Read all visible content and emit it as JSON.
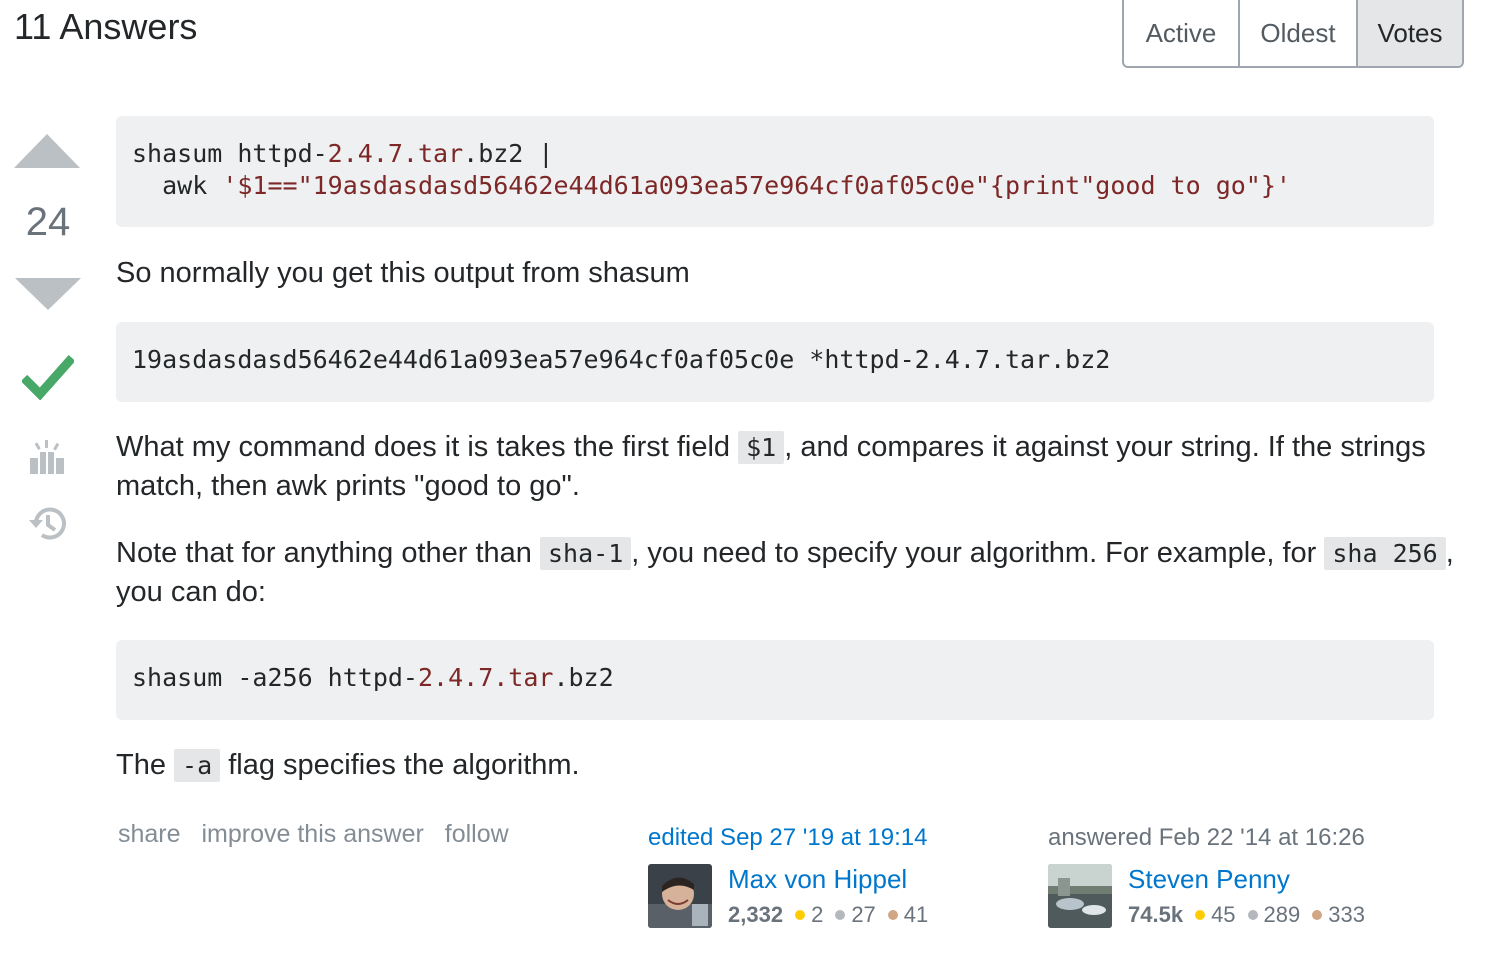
{
  "header": {
    "answers_count": "11 Answers",
    "sort_tabs": [
      {
        "label": "Active",
        "selected": false
      },
      {
        "label": "Oldest",
        "selected": false
      },
      {
        "label": "Votes",
        "selected": true
      }
    ]
  },
  "answer": {
    "score": "24",
    "accepted": true,
    "code_block_1": {
      "line1": [
        "shasum httpd-",
        "2.4.7.tar",
        ".bz2 |"
      ],
      "line2": [
        "  awk ",
        "'$1==\"19asdasdasd56462e44d61a093ea57e964cf0af05c0e\"{print\"good to go\"}'"
      ]
    },
    "paragraph_1": "So normally you get this output from shasum",
    "code_block_2": "19asdasdasd56462e44d61a093ea57e964cf0af05c0e *httpd-2.4.7.tar.bz2",
    "paragraph_2": {
      "text_before": "What my command does it is takes the first field ",
      "code": "$1",
      "text_after": ", and compares it against your string. If the strings match, then awk prints \"good to go\"."
    },
    "paragraph_3": {
      "text_before": "Note that for anything other than ",
      "code_1": "sha-1",
      "text_middle": ", you need to specify your algorithm. For example, for ",
      "code_2": "sha 256",
      "text_after": ", you can do:"
    },
    "code_block_3": [
      "shasum -a256 httpd-",
      "2.4.7.tar",
      ".bz2"
    ],
    "paragraph_4": {
      "text_before": "The ",
      "code": "-a",
      "text_after": " flag specifies the algorithm."
    },
    "post_menu": {
      "share": "share",
      "improve": "improve this answer",
      "follow": "follow"
    },
    "editor": {
      "action": "edited Sep 27 '19 at 19:14",
      "name": "Max von Hippel",
      "reputation": "2,332",
      "gold": "2",
      "silver": "27",
      "bronze": "41"
    },
    "author": {
      "action": "answered Feb 22 '14 at 16:26",
      "name": "Steven Penny",
      "reputation": "74.5k",
      "gold": "45",
      "silver": "289",
      "bronze": "333"
    }
  },
  "colors": {
    "link": "#0077cc",
    "accepted_check": "#48a868",
    "code_background": "#eff0f1",
    "string_literal": "#7d2727"
  },
  "icons": {
    "upvote": "arrow-up-icon",
    "downvote": "arrow-down-icon",
    "accepted": "check-icon",
    "bounty": "bounty-award-icon",
    "history": "history-icon"
  }
}
